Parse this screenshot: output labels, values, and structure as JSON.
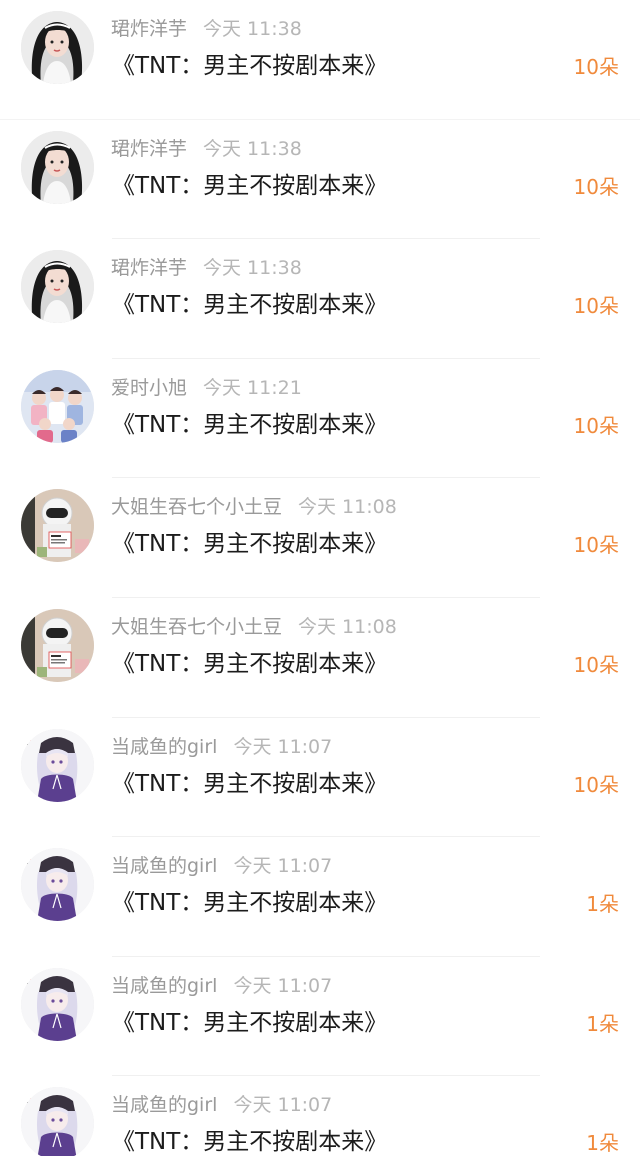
{
  "rows": [
    {
      "username": "珺炸洋芋",
      "time": "今天 11:38",
      "gift": "《TNT：男主不按剧本来》",
      "count": "10朵",
      "avatar_icon": "avatar-girl-icon"
    },
    {
      "username": "珺炸洋芋",
      "time": "今天 11:38",
      "gift": "《TNT：男主不按剧本来》",
      "count": "10朵",
      "avatar_icon": "avatar-girl-icon"
    },
    {
      "username": "珺炸洋芋",
      "time": "今天 11:38",
      "gift": "《TNT：男主不按剧本来》",
      "count": "10朵",
      "avatar_icon": "avatar-girl-icon"
    },
    {
      "username": "爱时小旭",
      "time": "今天 11:21",
      "gift": "《TNT：男主不按剧本来》",
      "count": "10朵",
      "avatar_icon": "avatar-group-icon"
    },
    {
      "username": "大姐生吞七个小土豆",
      "time": "今天 11:08",
      "gift": "《TNT：男主不按剧本来》",
      "count": "10朵",
      "avatar_icon": "avatar-astronaut-icon"
    },
    {
      "username": "大姐生吞七个小土豆",
      "time": "今天 11:08",
      "gift": "《TNT：男主不按剧本来》",
      "count": "10朵",
      "avatar_icon": "avatar-astronaut-icon"
    },
    {
      "username": "当咸鱼的girl",
      "time": "今天 11:07",
      "gift": "《TNT：男主不按剧本来》",
      "count": "10朵",
      "avatar_icon": "avatar-anime-icon"
    },
    {
      "username": "当咸鱼的girl",
      "time": "今天 11:07",
      "gift": "《TNT：男主不按剧本来》",
      "count": "1朵",
      "avatar_icon": "avatar-anime-icon"
    },
    {
      "username": "当咸鱼的girl",
      "time": "今天 11:07",
      "gift": "《TNT：男主不按剧本来》",
      "count": "1朵",
      "avatar_icon": "avatar-anime-icon"
    },
    {
      "username": "当咸鱼的girl",
      "time": "今天 11:07",
      "gift": "《TNT：男主不按剧本来》",
      "count": "1朵",
      "avatar_icon": "avatar-anime-icon"
    }
  ],
  "colors": {
    "count": "#f08a3c",
    "username": "#9a9a9a",
    "time": "#b6b6b6",
    "title": "#1c1c1c"
  }
}
